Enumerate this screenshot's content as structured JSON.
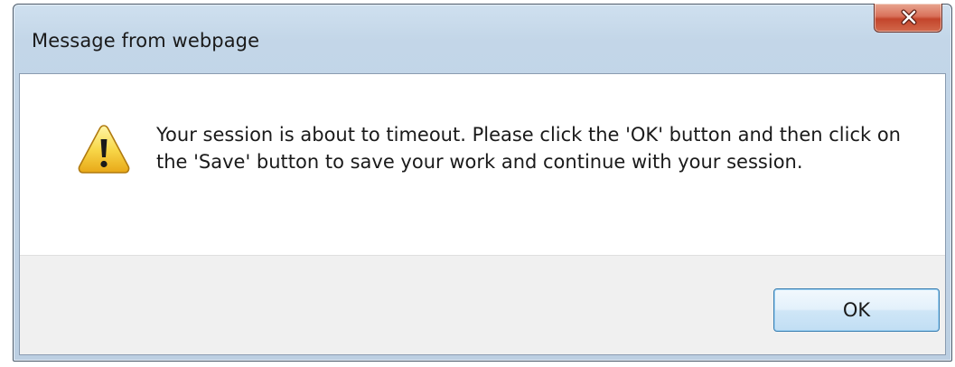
{
  "window": {
    "title": "Message from webpage",
    "close_icon": "close-icon"
  },
  "message": {
    "icon": "warning-icon",
    "text": "Your session is about to timeout. Please click the 'OK' button and then click on the 'Save' button to save your work and continue with your session."
  },
  "buttons": {
    "ok_label": "OK"
  },
  "colors": {
    "titlebar": "#c3d6e8",
    "close_button": "#c3452b",
    "footer": "#f0f0f0",
    "ok_border": "#3c7fb1"
  }
}
